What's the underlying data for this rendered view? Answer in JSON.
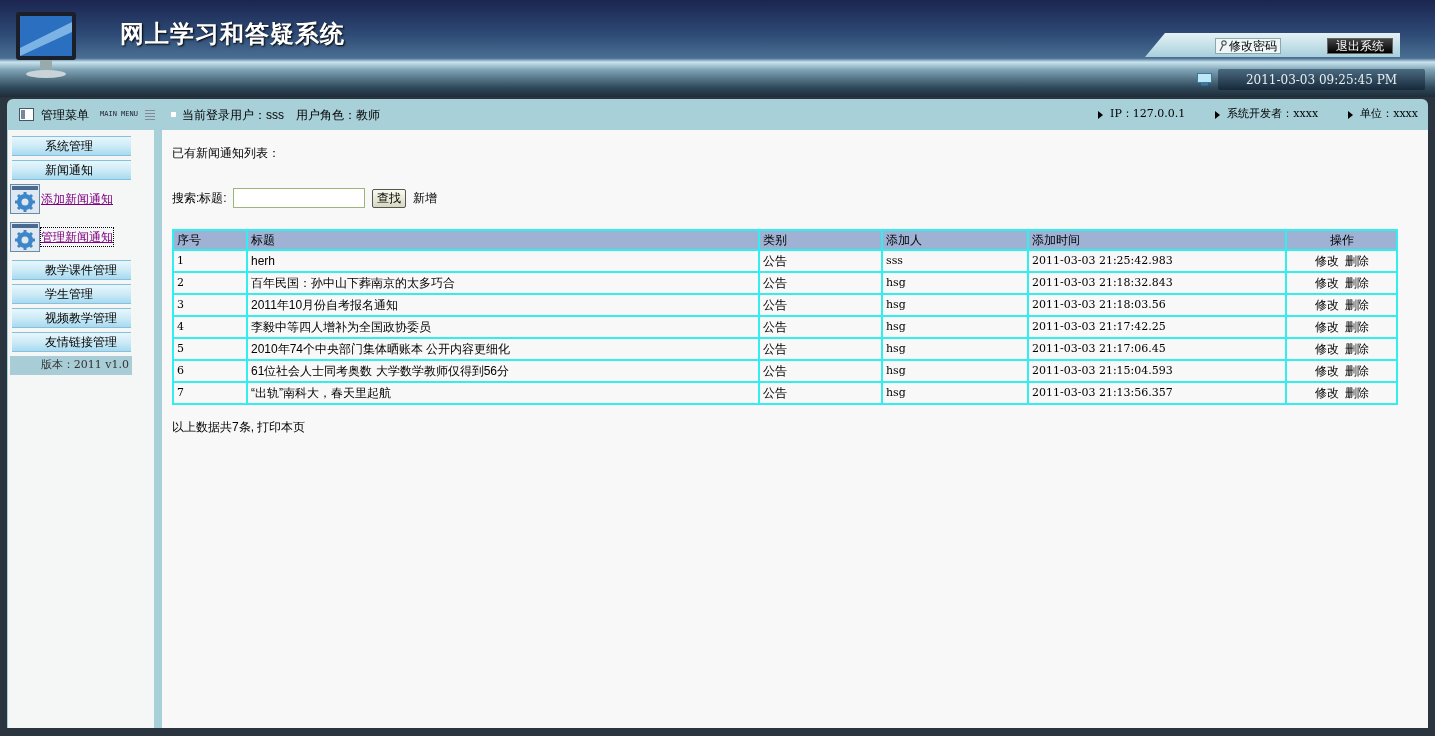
{
  "header": {
    "title": "网上学习和答疑系统",
    "buttons": [
      {
        "label": "修改密码",
        "kind": "key"
      },
      {
        "label": "退出系统",
        "kind": "dark"
      }
    ],
    "datetime": "2011-03-03 09:25:45 PM"
  },
  "infobar": {
    "menu_title": "管理菜单",
    "menu_subtitle": "MAIN MENU",
    "user_info": "当前登录用户：sss　用户角色：教师",
    "right_items": [
      "IP：127.0.0.1",
      "系统开发者：xxxx",
      "单位：xxxx"
    ]
  },
  "sidebar": {
    "items": [
      {
        "label": "系统管理",
        "kind": "group"
      },
      {
        "label": "新闻通知",
        "kind": "group"
      },
      {
        "label": "添加新闻通知",
        "kind": "link",
        "selected": false
      },
      {
        "label": "管理新闻通知",
        "kind": "link",
        "selected": true
      },
      {
        "label": "教学课件管理",
        "kind": "group"
      },
      {
        "label": "学生管理",
        "kind": "group"
      },
      {
        "label": "视频教学管理",
        "kind": "group"
      },
      {
        "label": "友情链接管理",
        "kind": "group"
      }
    ],
    "version": "版本：2011 v1.0"
  },
  "content": {
    "heading": "已有新闻通知列表：",
    "search": {
      "label": "搜索:标题:",
      "button": "查找",
      "add_link": "新增"
    },
    "table": {
      "columns": [
        "序号",
        "标题",
        "类别",
        "添加人",
        "添加时间",
        "操作"
      ],
      "rows": [
        {
          "cells": [
            "1",
            "herh",
            "公告",
            "sss",
            "2011-03-03 21:25:42.983"
          ],
          "actions": [
            "修改",
            "删除"
          ]
        },
        {
          "cells": [
            "2",
            "百年民国：孙中山下葬南京的太多巧合",
            "公告",
            "hsg",
            "2011-03-03 21:18:32.843"
          ],
          "actions": [
            "修改",
            "删除"
          ]
        },
        {
          "cells": [
            "3",
            "2011年10月份自考报名通知",
            "公告",
            "hsg",
            "2011-03-03 21:18:03.56"
          ],
          "actions": [
            "修改",
            "删除"
          ]
        },
        {
          "cells": [
            "4",
            "李毅中等四人增补为全国政协委员",
            "公告",
            "hsg",
            "2011-03-03 21:17:42.25"
          ],
          "actions": [
            "修改",
            "删除"
          ]
        },
        {
          "cells": [
            "5",
            "2010年74个中央部门集体晒账本 公开内容更细化",
            "公告",
            "hsg",
            "2011-03-03 21:17:06.45"
          ],
          "actions": [
            "修改",
            "删除"
          ]
        },
        {
          "cells": [
            "6",
            "61位社会人士同考奥数 大学数学教师仅得到56分",
            "公告",
            "hsg",
            "2011-03-03 21:15:04.593"
          ],
          "actions": [
            "修改",
            "删除"
          ]
        },
        {
          "cells": [
            "7",
            "“出轨”南科大，春天里起航",
            "公告",
            "hsg",
            "2011-03-03 21:13:56.357"
          ],
          "actions": [
            "修改",
            "删除"
          ]
        }
      ]
    },
    "footer": "以上数据共7条, 打印本页"
  }
}
